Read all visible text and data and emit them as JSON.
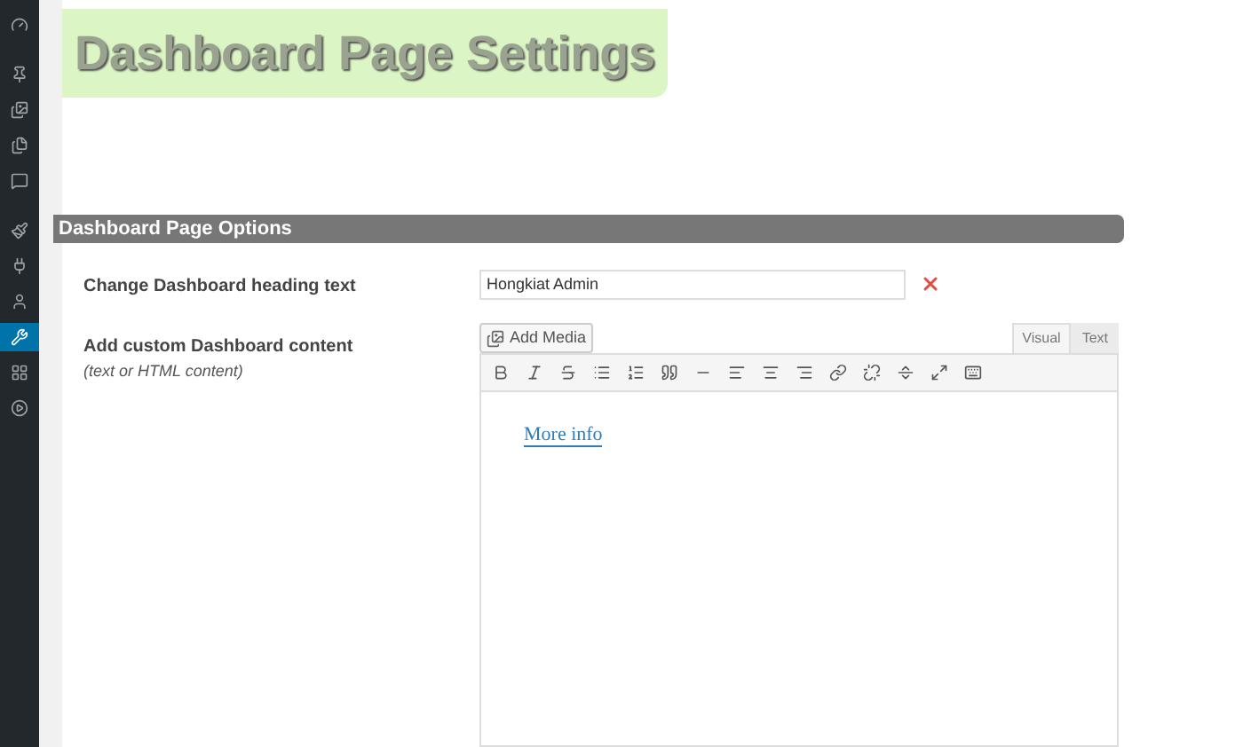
{
  "sidebar": {
    "items": [
      {
        "kind": "gauge",
        "selected": false
      },
      {
        "kind": "pin",
        "selected": false
      },
      {
        "kind": "media",
        "selected": false
      },
      {
        "kind": "pages",
        "selected": false
      },
      {
        "kind": "comment",
        "selected": false
      },
      {
        "kind": "brush",
        "selected": false
      },
      {
        "kind": "plug",
        "selected": false
      },
      {
        "kind": "user",
        "selected": false
      },
      {
        "kind": "wrench",
        "selected": true
      },
      {
        "kind": "grid",
        "selected": false
      },
      {
        "kind": "play",
        "selected": false
      }
    ]
  },
  "page_title": "Dashboard Page Settings",
  "section": {
    "title": "Dashboard Page Options"
  },
  "fields": [
    {
      "kind": "text",
      "label": "Change Dashboard heading text",
      "value": "Hongkiat Admin"
    },
    {
      "kind": "editor",
      "label": "Add custom Dashboard content",
      "hint": "(text or HTML content)",
      "add_media": "Add Media",
      "tabs": [
        {
          "label": "Visual",
          "selected": true
        },
        {
          "label": "Text",
          "selected": false
        }
      ],
      "content_link": "More info"
    }
  ]
}
